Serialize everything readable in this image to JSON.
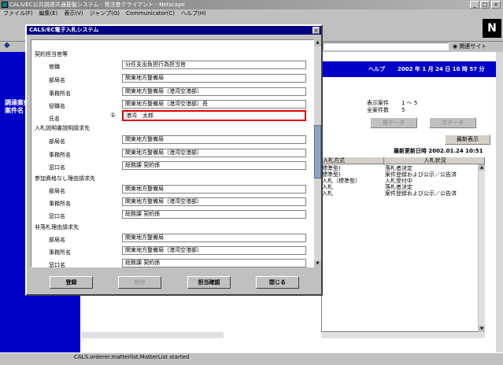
{
  "window": {
    "title": "CALS/EC公共調達共通基盤システム - 発注者クライアント - Netscape",
    "min": "_",
    "max": "□",
    "close": "×"
  },
  "menu": [
    "ファイル(F)",
    "編集(E)",
    "表示(V)",
    "ジャンプ(G)",
    "Communicator(C)",
    "ヘルプ(H)"
  ],
  "toolbar": {
    "related_sites": "関連サイト"
  },
  "page": {
    "left_label": "調達案件\n案件名",
    "help": "ヘルプ",
    "date": "2002 年  1 月 24 日  10 時 57 分",
    "display_label": "表示案件\n全案件数",
    "display_values": "1 ～ 5\n5",
    "prev": "前データ",
    "next": "次データ",
    "refresh": "最新表示",
    "last_update": "最新更新日時 2002.01.24 10:51"
  },
  "table": {
    "headers": [
      "入札方式",
      "入札状況"
    ],
    "rows": [
      [
        "標準型)",
        "落札者決定"
      ],
      [
        "標準型)",
        "案件登録および公示／公告済"
      ],
      [
        "入札（標準型）",
        "入札受付中"
      ],
      [
        "入札",
        "落札者決定"
      ],
      [
        "入札",
        "案件登録および公示／公告済"
      ]
    ]
  },
  "status": {
    "text": "CALS.orderer.matterlist.MatterList started"
  },
  "dialog": {
    "title": "CALS/EC電子入札システム",
    "close": "×",
    "sections": {
      "contract_officer": "契約担当官等",
      "explanation": "入札説明書説明請求先",
      "qualification": "参加資格なし理由請求先",
      "non_award": "非落札理由請求先"
    },
    "labels": {
      "position": "官職",
      "department": "部局名",
      "office": "事務所名",
      "title": "役職名",
      "name": "氏名",
      "window": "窓口名"
    },
    "values": {
      "position": "分任支出負担行為担当官",
      "department": "関東地方整備局",
      "office": "関東地方整備局（港湾空港部）",
      "title": "関東地方整備局（港湾空港部）長",
      "name": "港湾　太郎",
      "exp_department": "関東地方整備局",
      "exp_office": "関東地方整備局（港湾空港部）",
      "exp_window": "総務課 契約係",
      "qual_department": "関東地方整備局",
      "qual_office": "関東地方整備局（港湾空港部）",
      "qual_window": "総務課 契約係",
      "na_department": "関東地方整備局",
      "na_office": "関東地方整備局（港湾空港部）",
      "na_window": "総務課 契約係"
    },
    "marker": "①",
    "buttons": {
      "register": "登録",
      "delete": "削除",
      "confirm": "担当確認",
      "close": "閉じる"
    }
  }
}
